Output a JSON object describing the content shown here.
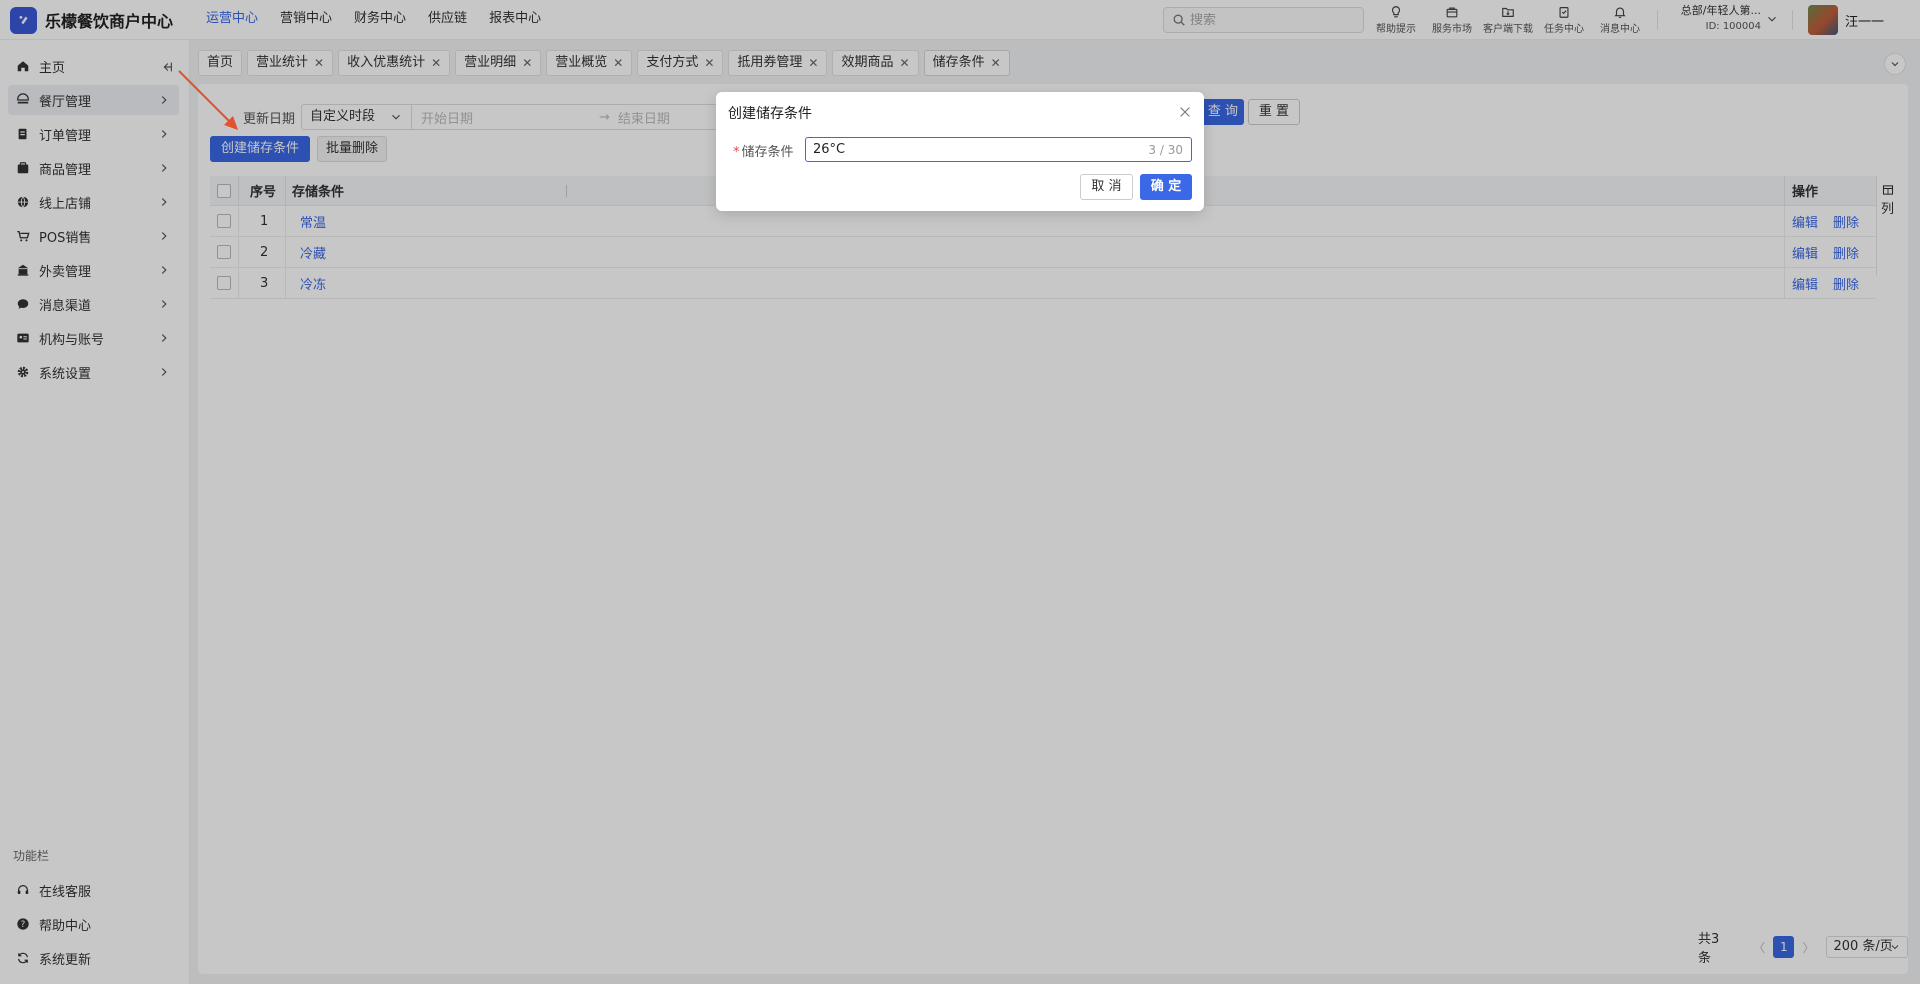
{
  "app": {
    "title": "乐檬餐饮商户中心"
  },
  "topnav": [
    {
      "label": "运营中心",
      "active": true
    },
    {
      "label": "营销中心"
    },
    {
      "label": "财务中心"
    },
    {
      "label": "供应链"
    },
    {
      "label": "报表中心"
    }
  ],
  "search": {
    "placeholder": "搜索"
  },
  "tools": [
    {
      "label": "帮助提示",
      "icon": "lightbulb-icon"
    },
    {
      "label": "服务市场",
      "icon": "store-icon"
    },
    {
      "label": "客户端下载",
      "icon": "download-folder-icon"
    },
    {
      "label": "任务中心",
      "icon": "clipboard-icon"
    },
    {
      "label": "消息中心",
      "icon": "bell-icon"
    }
  ],
  "org": {
    "name": "总部/年轻人第...",
    "id": "ID: 100004"
  },
  "user": {
    "name": "汪一一"
  },
  "sidebar": {
    "items": [
      {
        "label": "主页",
        "icon": "home-icon"
      },
      {
        "label": "餐厅管理",
        "icon": "restaurant-icon",
        "active": true
      },
      {
        "label": "订单管理",
        "icon": "order-icon"
      },
      {
        "label": "商品管理",
        "icon": "goods-icon"
      },
      {
        "label": "线上店铺",
        "icon": "globe-icon"
      },
      {
        "label": "POS销售",
        "icon": "pos-icon"
      },
      {
        "label": "外卖管理",
        "icon": "takeout-icon"
      },
      {
        "label": "消息渠道",
        "icon": "message-icon"
      },
      {
        "label": "机构与账号",
        "icon": "account-icon"
      },
      {
        "label": "系统设置",
        "icon": "gear-icon"
      }
    ],
    "func_title": "功能栏",
    "func_items": [
      {
        "label": "在线客服",
        "icon": "headset-icon"
      },
      {
        "label": "帮助中心",
        "icon": "help-icon"
      },
      {
        "label": "系统更新",
        "icon": "refresh-icon"
      }
    ]
  },
  "tabs": [
    {
      "label": "首页",
      "closable": false
    },
    {
      "label": "营业统计",
      "closable": true
    },
    {
      "label": "收入优惠统计",
      "closable": true
    },
    {
      "label": "营业明细",
      "closable": true
    },
    {
      "label": "营业概览",
      "closable": true
    },
    {
      "label": "支付方式",
      "closable": true
    },
    {
      "label": "抵用券管理",
      "closable": true
    },
    {
      "label": "效期商品",
      "closable": true
    },
    {
      "label": "储存条件",
      "closable": true,
      "active": true
    }
  ],
  "filter": {
    "label": "更新日期",
    "range_type": "自定义时段",
    "start_placeholder": "开始日期",
    "arrow": "→",
    "end_placeholder": "结束日期",
    "query": "查 询",
    "reset": "重 置"
  },
  "actions": {
    "create": "创建储存条件",
    "batch_delete": "批量删除"
  },
  "table": {
    "headers": {
      "index": "序号",
      "condition": "存储条件",
      "ops": "操作"
    },
    "rows": [
      {
        "index": "1",
        "condition": "常温"
      },
      {
        "index": "2",
        "condition": "冷藏"
      },
      {
        "index": "3",
        "condition": "冷冻"
      }
    ],
    "edit": "编辑",
    "delete": "删除",
    "column_setting": "列"
  },
  "pager": {
    "total": "共3条",
    "page": "1",
    "size": "200 条/页"
  },
  "modal": {
    "title": "创建储存条件",
    "required": "*",
    "label": "储存条件",
    "value": "26°C",
    "count": "3 / 30",
    "cancel": "取 消",
    "ok": "确 定"
  },
  "colors": {
    "primary": "#3a68e6",
    "annotation": "#e5502e"
  }
}
